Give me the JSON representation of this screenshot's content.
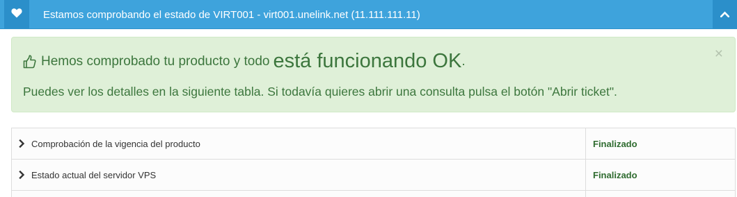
{
  "header": {
    "title": "Estamos comprobando el estado de VIRT001 - virt001.unelink.net (11.111.111.11)",
    "left_icon": "heart-icon",
    "right_icon": "chevron-up-icon",
    "accent_color": "#3ea3dc"
  },
  "alert": {
    "icon": "thumbs-up-icon",
    "line1_prefix": "Hemos comprobado tu producto y todo",
    "line1_emphasis": "está funcionando OK",
    "line1_suffix": ".",
    "line2": "Puedes ver los detalles en la siguiente tabla. Si todavía quieres abrir una consulta pulsa el botón \"Abrir ticket\".",
    "close_label": "×",
    "color": "#3c763d",
    "background": "#dff0d8"
  },
  "table": {
    "rows": [
      {
        "label": "Comprobación de la vigencia del producto",
        "status": "Finalizado"
      },
      {
        "label": "Estado actual del servidor VPS",
        "status": "Finalizado"
      }
    ]
  }
}
